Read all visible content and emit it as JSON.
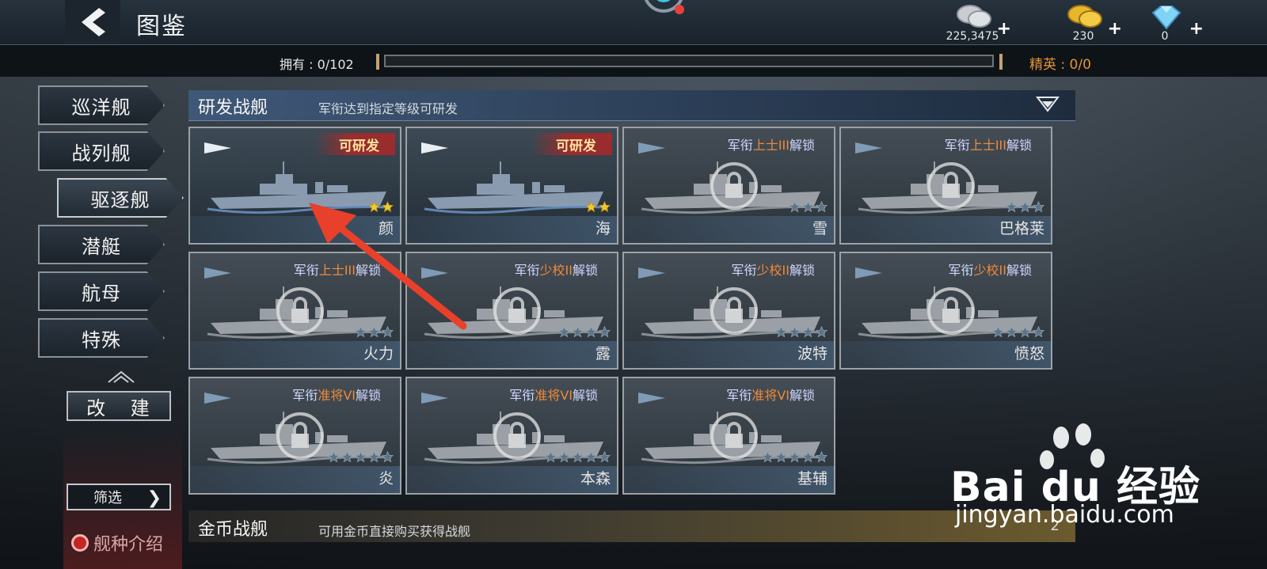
{
  "header": {
    "title": "图鉴"
  },
  "resources": [
    {
      "name": "silver",
      "value": "225,3475",
      "plus": "+"
    },
    {
      "name": "gold",
      "value": "230",
      "plus": "+"
    },
    {
      "name": "diamond",
      "value": "0",
      "plus": "+"
    }
  ],
  "collection": {
    "owned_label": "拥有 : 0/102",
    "owned_fraction": 0,
    "elite_label": "精英 : 0/0"
  },
  "tabs": [
    {
      "label": "巡洋舰",
      "active": false
    },
    {
      "label": "战列舰",
      "active": false
    },
    {
      "label": "驱逐舰",
      "active": true
    },
    {
      "label": "潜艇",
      "active": false
    },
    {
      "label": "航母",
      "active": false
    },
    {
      "label": "特殊",
      "active": false
    }
  ],
  "sidebar": {
    "modify_label": "改 建",
    "filter_label": "筛选",
    "intro_label": "舰种介绍"
  },
  "sections": {
    "research": {
      "title": "研发战舰",
      "subtitle": "军衔达到指定等级可研发"
    },
    "gold": {
      "title": "金币战舰",
      "subtitle": "可用金币直接购买获得战舰",
      "count": "2"
    }
  },
  "ships": [
    {
      "name": "颜",
      "status": "可研发",
      "stars": 2,
      "locked": false
    },
    {
      "name": "海",
      "status": "可研发",
      "stars": 2,
      "locked": false
    },
    {
      "name": "雪",
      "req_prefix": "军衔",
      "req_rank": "上士III",
      "req_suffix": "解锁",
      "stars": 3,
      "locked": true
    },
    {
      "name": "巴格莱",
      "req_prefix": "军衔",
      "req_rank": "上士III",
      "req_suffix": "解锁",
      "stars": 3,
      "locked": true
    },
    {
      "name": "火力",
      "req_prefix": "军衔",
      "req_rank": "上士III",
      "req_suffix": "解锁",
      "stars": 3,
      "locked": true
    },
    {
      "name": "露",
      "req_prefix": "军衔",
      "req_rank": "少校II",
      "req_suffix": "解锁",
      "stars": 4,
      "locked": true
    },
    {
      "name": "波特",
      "req_prefix": "军衔",
      "req_rank": "少校II",
      "req_suffix": "解锁",
      "stars": 4,
      "locked": true
    },
    {
      "name": "愤怒",
      "req_prefix": "军衔",
      "req_rank": "少校II",
      "req_suffix": "解锁",
      "stars": 4,
      "locked": true
    },
    {
      "name": "炎",
      "req_prefix": "军衔",
      "req_rank": "准将VI",
      "req_suffix": "解锁",
      "stars": 5,
      "locked": true
    },
    {
      "name": "本森",
      "req_prefix": "军衔",
      "req_rank": "准将VI",
      "req_suffix": "解锁",
      "stars": 5,
      "locked": true
    },
    {
      "name": "基辅",
      "req_prefix": "军衔",
      "req_rank": "准将VI",
      "req_suffix": "解锁",
      "stars": 5,
      "locked": true
    }
  ],
  "watermark": {
    "logo": "Bai du 经验",
    "url": "jingyan.baidu.com"
  },
  "colors": {
    "accent_orange": "#e49338",
    "rank_orange": "#f08a3a",
    "badge_red": "#aa2828",
    "arrow_red": "#e8402a"
  }
}
